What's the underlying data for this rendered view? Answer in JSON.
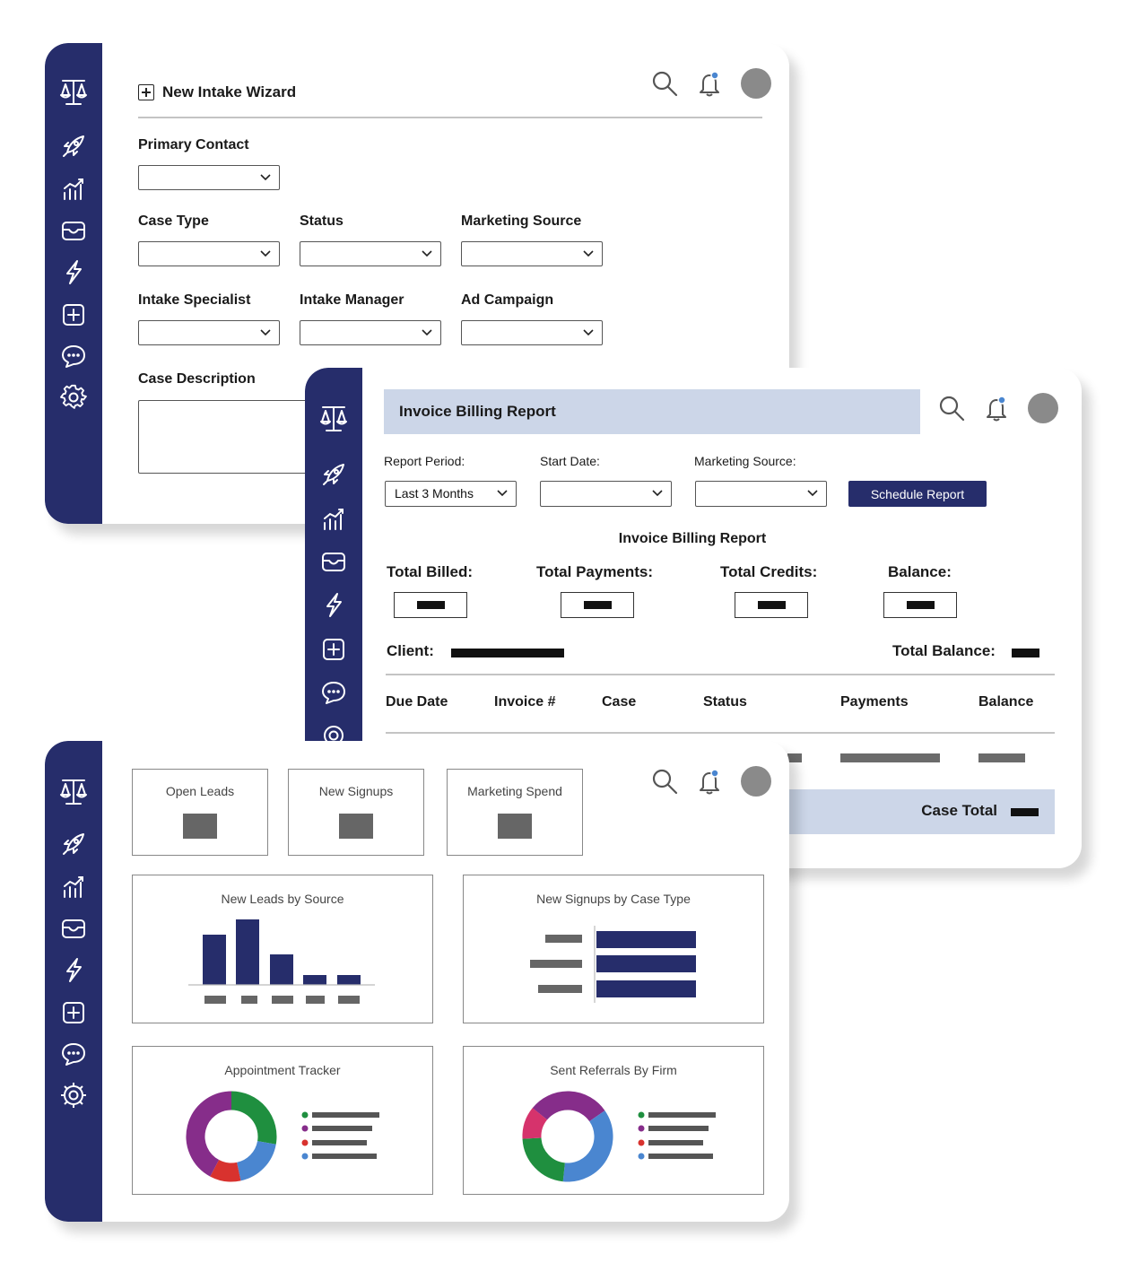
{
  "colors": {
    "brand_navy": "#262d6b",
    "banner_blue": "#ccd6e8",
    "notify_dot": "#4a86d0",
    "donut_green": "#1f8f3f",
    "donut_blue": "#4a86d0",
    "donut_red": "#d8322e",
    "donut_purple": "#862d8a",
    "donut_pink": "#d6336c"
  },
  "icons": {
    "logo": "scales-of-justice-icon",
    "nav": [
      "rocket-icon",
      "bar-chart-icon",
      "inbox-icon",
      "lightning-icon",
      "plus-square-icon",
      "chat-bubble-icon",
      "gear-icon"
    ],
    "header": [
      "search-icon",
      "bell-icon",
      "avatar"
    ]
  },
  "intake": {
    "title": "New Intake Wizard",
    "primary_contact": "Primary Contact",
    "case_type": "Case Type",
    "status": "Status",
    "marketing_source": "Marketing Source",
    "intake_specialist": "Intake Specialist",
    "intake_manager": "Intake Manager",
    "ad_campaign": "Ad Campaign",
    "case_description": "Case Description"
  },
  "invoice": {
    "banner_title": "Invoice Billing Report",
    "report_period_label": "Report Period:",
    "report_period_value": "Last 3 Months",
    "start_date_label": "Start Date:",
    "marketing_source_label": "Marketing Source:",
    "schedule_button": "Schedule Report",
    "section_title": "Invoice Billing Report",
    "total_billed": "Total Billed:",
    "total_payments": "Total Payments:",
    "total_credits": "Total Credits:",
    "balance": "Balance:",
    "client": "Client:",
    "total_balance": "Total Balance:",
    "columns": [
      "Due Date",
      "Invoice #",
      "Case",
      "Status",
      "Payments",
      "Balance"
    ],
    "case_total": "Case Total"
  },
  "dashboard": {
    "kpis": [
      "Open Leads",
      "New Signups",
      "Marketing Spend"
    ],
    "panels": {
      "leads_by_source": "New Leads by Source",
      "signups_by_case_type": "New Signups by Case Type",
      "appointment_tracker": "Appointment Tracker",
      "referrals_by_firm": "Sent Referrals By Firm"
    }
  }
}
